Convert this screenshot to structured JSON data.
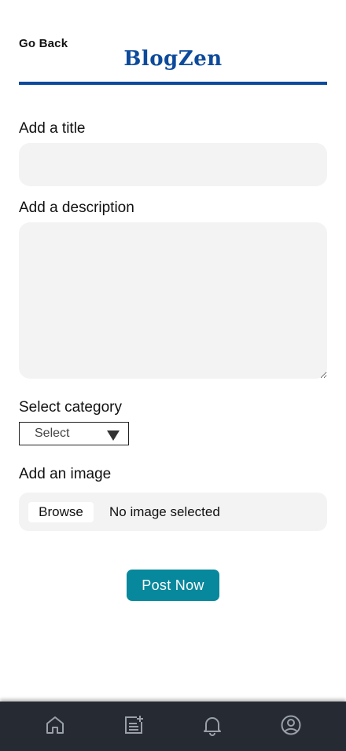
{
  "header": {
    "back_label": "Go Back",
    "brand": "BlogZen",
    "brand_color": "#0d4a9b"
  },
  "form": {
    "title_label": "Add a title",
    "title_value": "",
    "description_label": "Add a description",
    "description_value": "",
    "category_label": "Select category",
    "category_selected": "Select",
    "image_label": "Add an image",
    "browse_label": "Browse",
    "file_status": "No image selected",
    "submit_label": "Post Now",
    "submit_color": "#08889c"
  },
  "bottom_nav": {
    "background": "#262b33",
    "items": [
      {
        "icon": "home-icon"
      },
      {
        "icon": "new-post-icon"
      },
      {
        "icon": "bell-icon"
      },
      {
        "icon": "profile-icon"
      }
    ]
  }
}
